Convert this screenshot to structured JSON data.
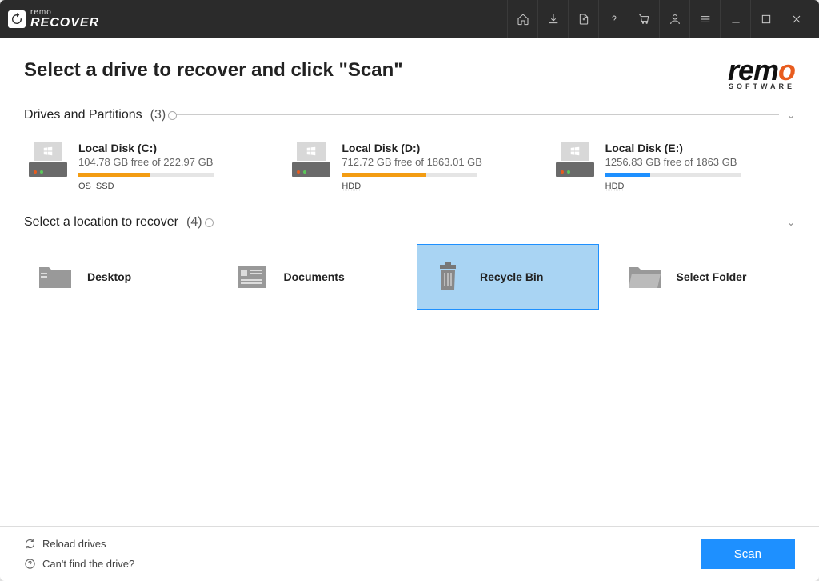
{
  "titlebar": {
    "brand": "remo",
    "product": "RECOVER"
  },
  "header": {
    "title": "Select a drive to recover and click \"Scan\"",
    "brand_main": "rem",
    "brand_accent": "o",
    "brand_sub": "SOFTWARE"
  },
  "sections": {
    "drives": {
      "label": "Drives and Partitions",
      "count": "(3)"
    },
    "locations": {
      "label": "Select a location to recover",
      "count": "(4)"
    }
  },
  "drives": [
    {
      "name": "Local Disk (C:)",
      "free": "104.78 GB free of 222.97 GB",
      "tags": [
        "OS",
        "SSD"
      ],
      "fill_pct": 53,
      "fill_color": "orange"
    },
    {
      "name": "Local Disk (D:)",
      "free": "712.72 GB free of 1863.01 GB",
      "tags": [
        "HDD"
      ],
      "fill_pct": 62,
      "fill_color": "orange"
    },
    {
      "name": "Local Disk (E:)",
      "free": "1256.83 GB free of 1863 GB",
      "tags": [
        "HDD"
      ],
      "fill_pct": 33,
      "fill_color": "blue"
    }
  ],
  "locations": [
    {
      "label": "Desktop",
      "icon": "folder"
    },
    {
      "label": "Documents",
      "icon": "documents"
    },
    {
      "label": "Recycle Bin",
      "icon": "trash",
      "selected": true
    },
    {
      "label": "Select Folder",
      "icon": "open-folder"
    }
  ],
  "footer": {
    "reload": "Reload drives",
    "help": "Can't find the drive?",
    "scan": "Scan"
  }
}
